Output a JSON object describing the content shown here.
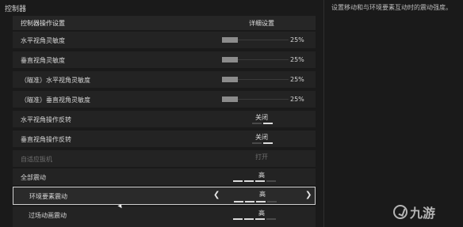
{
  "panel": {
    "title": "控制器",
    "description": "设置移动和与环境要素互动时的震动强度。"
  },
  "header": {
    "name": "控制器操作设置",
    "detail": "详细设置"
  },
  "sliders": [
    {
      "label": "水平视角灵敏度",
      "value": "25%",
      "level": 0.25
    },
    {
      "label": "垂直视角灵敏度",
      "value": "25%",
      "level": 0.25
    },
    {
      "label": "（瞄准）水平视角灵敏度",
      "value": "25%",
      "level": 0.25
    },
    {
      "label": "（瞄准）垂直视角灵敏度",
      "value": "25%",
      "level": 0.25
    }
  ],
  "options": [
    {
      "label": "水平视角操作反转",
      "value": "关闭",
      "segments": 2,
      "on": 1,
      "disabled": false
    },
    {
      "label": "垂直视角操作反转",
      "value": "关闭",
      "segments": 2,
      "on": 1,
      "disabled": false
    },
    {
      "label": "自适应扳机",
      "value": "打开",
      "segments": 2,
      "on": 2,
      "disabled": true
    },
    {
      "label": "全部震动",
      "value": "高",
      "segments": 4,
      "on": 3,
      "disabled": false
    },
    {
      "label": "环境要素震动",
      "value": "高",
      "segments": 4,
      "on": 3,
      "disabled": false,
      "selected": true
    },
    {
      "label": "过场动画震动",
      "value": "高",
      "segments": 4,
      "on": 3,
      "disabled": false
    }
  ],
  "arrows": {
    "left": "❮",
    "right": "❯"
  },
  "watermark": {
    "text": "九游"
  }
}
